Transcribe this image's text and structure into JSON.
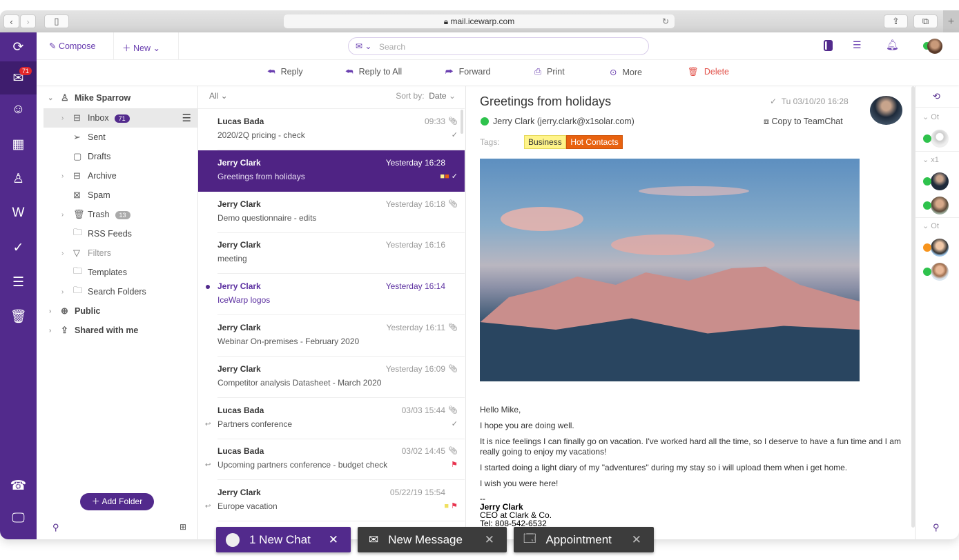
{
  "browser": {
    "url": "mail.icewarp.com"
  },
  "rail": {
    "mail_badge": "71"
  },
  "topbar": {
    "compose": "Compose",
    "new": "New",
    "search_placeholder": "Search"
  },
  "actions": [
    {
      "label": "Reply",
      "icon": "reply"
    },
    {
      "label": "Reply to All",
      "icon": "reply-all"
    },
    {
      "label": "Forward",
      "icon": "forward"
    },
    {
      "label": "Print",
      "icon": "printer"
    },
    {
      "label": "More",
      "icon": "more"
    },
    {
      "label": "Delete",
      "icon": "trash"
    }
  ],
  "folders": {
    "account": "Mike Sparrow",
    "items": [
      {
        "label": "Inbox",
        "count": "71"
      },
      {
        "label": "Sent"
      },
      {
        "label": "Drafts"
      },
      {
        "label": "Archive"
      },
      {
        "label": "Spam"
      },
      {
        "label": "Trash",
        "count": "13"
      },
      {
        "label": "RSS Feeds"
      },
      {
        "label": "Filters"
      },
      {
        "label": "Templates"
      },
      {
        "label": "Search Folders"
      }
    ],
    "public": "Public",
    "shared": "Shared with me",
    "add_folder": "Add Folder"
  },
  "list": {
    "filter": "All",
    "sort_label": "Sort by:",
    "sort_value": "Date",
    "messages": [
      {
        "from": "Lucas Bada",
        "subject": "2020/2Q pricing - check",
        "time": "09:33"
      },
      {
        "from": "Jerry Clark",
        "subject": "Greetings from holidays",
        "time": "Yesterday 16:28"
      },
      {
        "from": "Jerry Clark",
        "subject": "Demo questionnaire - edits",
        "time": "Yesterday 16:18"
      },
      {
        "from": "Jerry Clark",
        "subject": "meeting",
        "time": "Yesterday 16:16"
      },
      {
        "from": "Jerry Clark",
        "subject": "IceWarp logos",
        "time": "Yesterday 16:14"
      },
      {
        "from": "Jerry Clark",
        "subject": "Webinar On-premises - February 2020",
        "time": "Yesterday 16:11"
      },
      {
        "from": "Jerry Clark",
        "subject": "Competitor analysis Datasheet - March 2020",
        "time": "Yesterday 16:09"
      },
      {
        "from": "Lucas Bada",
        "subject": "Partners conference",
        "time": "03/03 15:44"
      },
      {
        "from": "Lucas Bada",
        "subject": "Upcoming partners conference - budget check",
        "time": "03/02 14:45"
      },
      {
        "from": "Jerry Clark",
        "subject": "Europe vacation",
        "time": "05/22/19 15:54"
      }
    ]
  },
  "reading": {
    "subject": "Greetings from holidays",
    "date": "Tu 03/10/20 16:28",
    "sender": "Jerry Clark (jerry.clark@x1solar.com)",
    "copy": "Copy to TeamChat",
    "tags_label": "Tags:",
    "tags": [
      {
        "label": "Business",
        "color": "#fff48a"
      },
      {
        "label": "Hot Contacts",
        "color": "#e8620f"
      }
    ],
    "body": [
      "Hello Mike,",
      "I hope you are doing well.",
      "It is nice feelings I can finally go on vacation. I've worked hard all the time, so I deserve to have a fun time and I am really going to enjoy my vacations!",
      "I started doing a light diary of my \"adventures\" during my stay so i will upload them when i get home.",
      "I wish you were here!"
    ],
    "sig_dash": "--",
    "sig_name": "Jerry Clark",
    "sig_title": "CEO at Clark & Co.",
    "sig_tel": "Tel: 808-542-6532"
  },
  "contacts": {
    "groups": [
      "Ot",
      "x1",
      "Ot"
    ]
  },
  "bottom": {
    "chat": "1 New Chat",
    "message": "New Message",
    "appointment": "Appointment"
  },
  "colors": {
    "brand": "#522a8c",
    "selected": "#4f2384",
    "delete": "#e2524a",
    "online": "#2ec24c",
    "away": "#f7941d"
  }
}
